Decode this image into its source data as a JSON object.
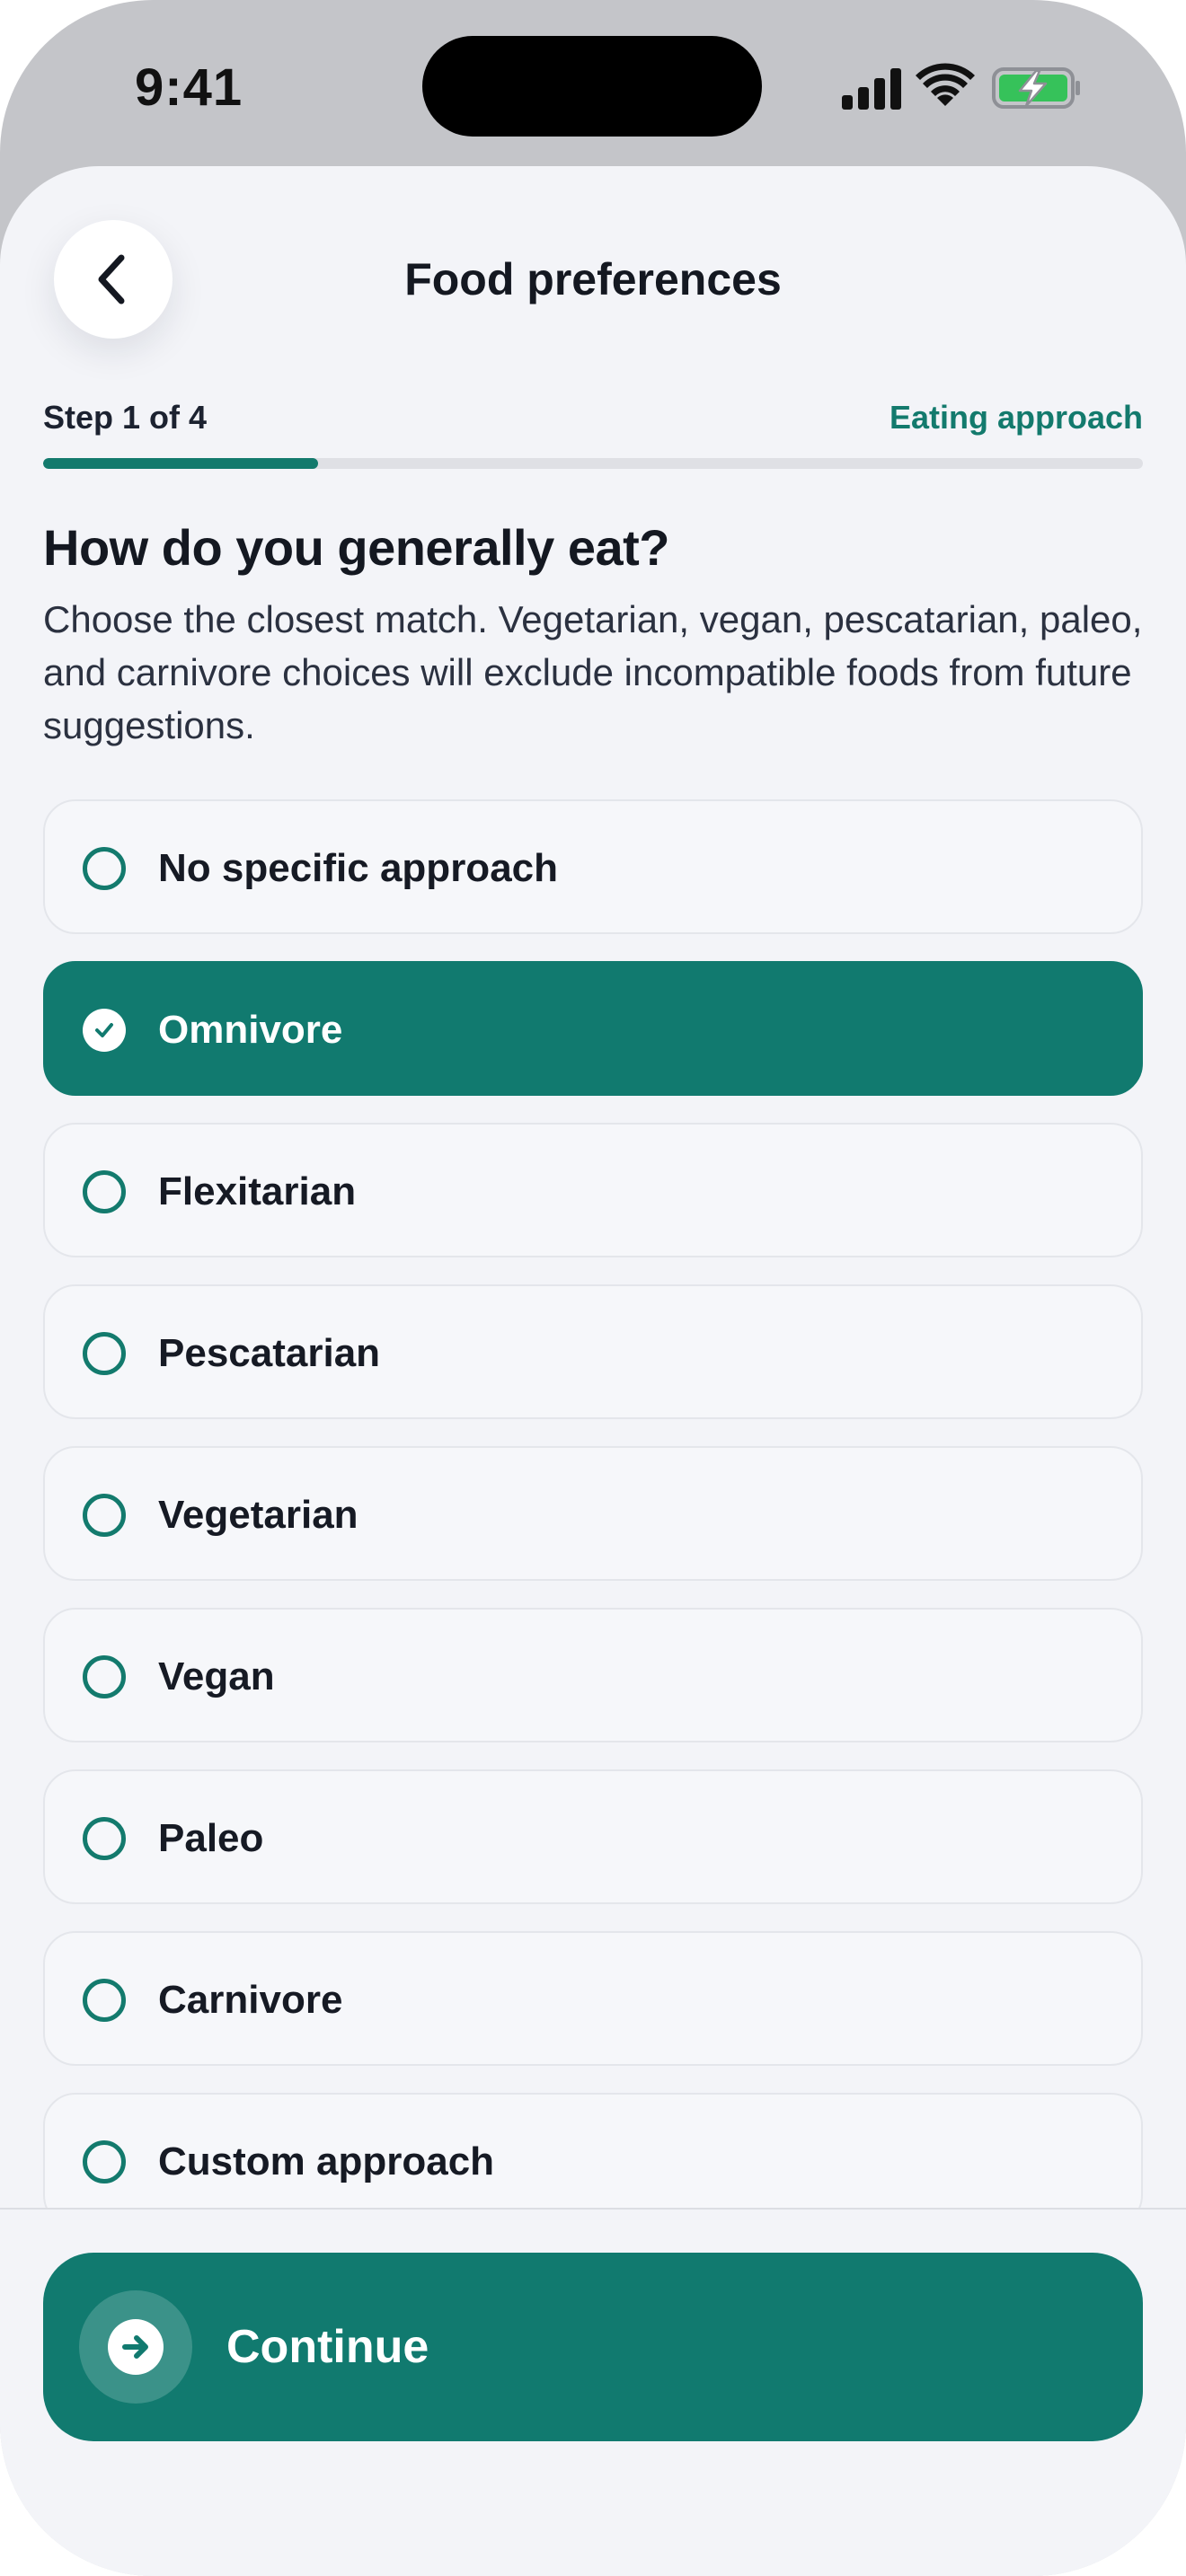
{
  "status_bar": {
    "time": "9:41",
    "icons": [
      "signal-icon",
      "wifi-icon",
      "battery-charging-icon"
    ],
    "battery_color": "#36c25a"
  },
  "header": {
    "title": "Food preferences",
    "back_icon": "chevron-left-icon"
  },
  "progress": {
    "step_label": "Step 1 of 4",
    "step_name": "Eating approach",
    "current_step": 1,
    "total_steps": 4,
    "fill_fraction": 0.25
  },
  "question": {
    "title": "How do you generally eat?",
    "subtitle": "Choose the closest match. Vegetarian, vegan, pescatarian, paleo, and carnivore choices will exclude incompatible foods from future suggestions."
  },
  "options": [
    {
      "label": "No specific approach",
      "selected": false
    },
    {
      "label": "Omnivore",
      "selected": true
    },
    {
      "label": "Flexitarian",
      "selected": false
    },
    {
      "label": "Pescatarian",
      "selected": false
    },
    {
      "label": "Vegetarian",
      "selected": false
    },
    {
      "label": "Vegan",
      "selected": false
    },
    {
      "label": "Paleo",
      "selected": false
    },
    {
      "label": "Carnivore",
      "selected": false
    },
    {
      "label": "Custom approach",
      "selected": false
    }
  ],
  "footer": {
    "continue_label": "Continue",
    "continue_icon": "arrow-right-icon"
  },
  "colors": {
    "accent": "#117a6f",
    "accent_text": "#137a6d",
    "background": "#f3f4f8",
    "frame": "#c4c5c9"
  }
}
